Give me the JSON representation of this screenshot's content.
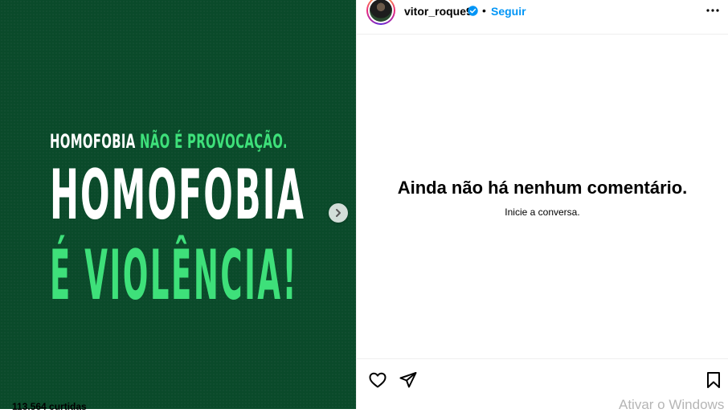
{
  "post_image": {
    "line1_white": "HOMOFOBIA",
    "line1_green": "NÃO É PROVOCAÇÃO.",
    "line2": "HOMOFOBIA",
    "line3": "É VIOLÊNCIA!",
    "background_color": "#0a4a2a",
    "accent_color": "#3ee07a"
  },
  "header": {
    "username": "vitor_roque9",
    "separator": "•",
    "follow_label": "Seguir"
  },
  "comments": {
    "empty_title": "Ainda não há nenhum comentário.",
    "empty_subtitle": "Inicie a conversa."
  },
  "footer": {
    "likes": "113.564 curtidas"
  },
  "overlay": {
    "watermark": "Ativar o Windows"
  },
  "icons": {
    "next": "chevron-right-icon",
    "verified": "verified-badge-icon",
    "more": "more-options-icon",
    "like": "heart-icon",
    "share": "paper-plane-icon",
    "save": "bookmark-icon"
  }
}
